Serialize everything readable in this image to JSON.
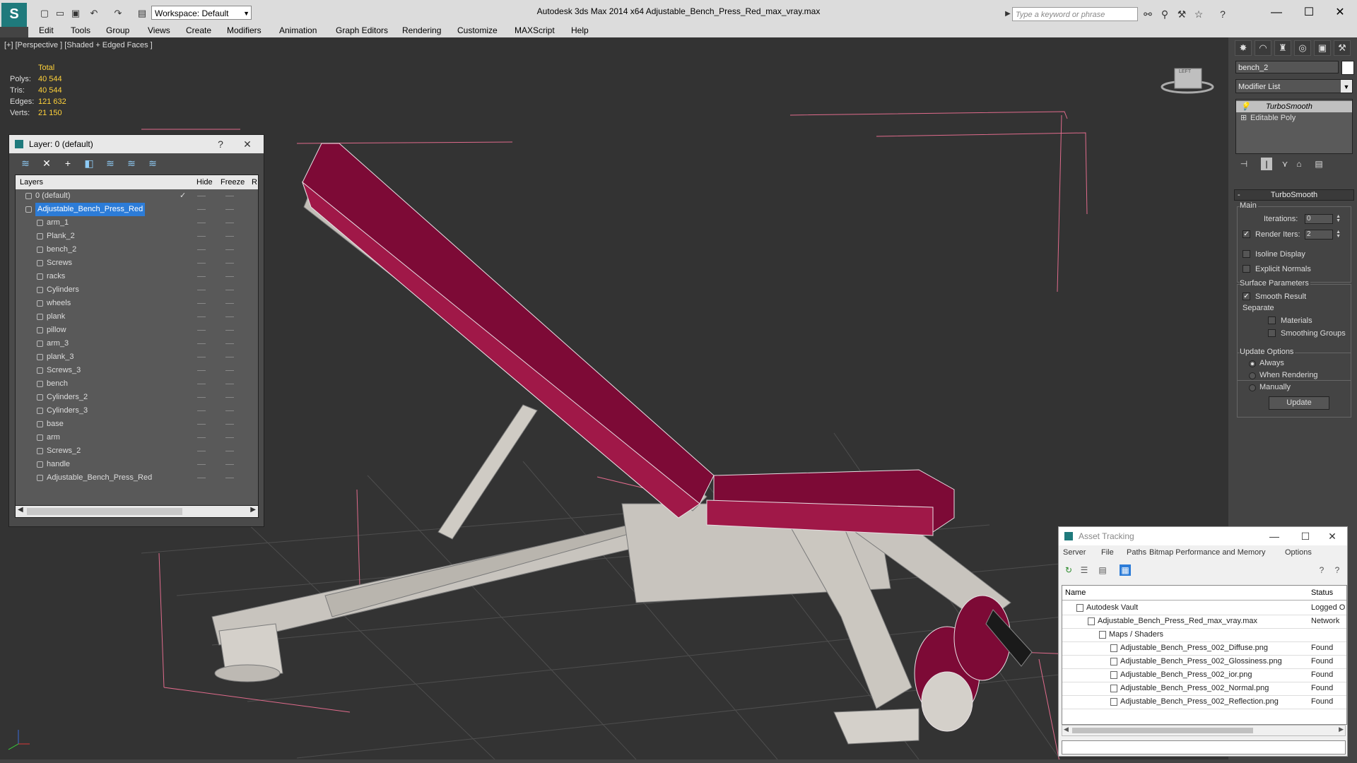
{
  "app": {
    "title": "Autodesk 3ds Max  2014 x64     Adjustable_Bench_Press_Red_max_vray.max",
    "workspace": "Workspace: Default",
    "search_placeholder": "Type a keyword or phrase"
  },
  "menu": [
    "Edit",
    "Tools",
    "Group",
    "Views",
    "Create",
    "Modifiers",
    "Animation",
    "Graph Editors",
    "Rendering",
    "Customize",
    "MAXScript",
    "Help"
  ],
  "viewport": {
    "label": "[+] [Perspective ] [Shaded + Edged Faces ]",
    "stats_header": "Total",
    "stats": [
      {
        "key": "Polys:",
        "value": "40 544"
      },
      {
        "key": "Tris:",
        "value": "40 544"
      },
      {
        "key": "Edges:",
        "value": "121 632"
      },
      {
        "key": "Verts:",
        "value": "21 150"
      }
    ],
    "viewcube_label": "LEFT"
  },
  "layer_panel": {
    "title": "Layer: 0 (default)",
    "help": "?",
    "close": "✕",
    "columns": [
      "Layers",
      "Hide",
      "Freeze",
      "R"
    ],
    "rows": [
      {
        "name": "0 (default)",
        "level": 1,
        "active": true
      },
      {
        "name": "Adjustable_Bench_Press_Red",
        "level": 1,
        "selected": true
      },
      {
        "name": "arm_1",
        "level": 2
      },
      {
        "name": "Plank_2",
        "level": 2
      },
      {
        "name": "bench_2",
        "level": 2
      },
      {
        "name": "Screws",
        "level": 2
      },
      {
        "name": "racks",
        "level": 2
      },
      {
        "name": "Cylinders",
        "level": 2
      },
      {
        "name": "wheels",
        "level": 2
      },
      {
        "name": "plank",
        "level": 2
      },
      {
        "name": "pillow",
        "level": 2
      },
      {
        "name": "arm_3",
        "level": 2
      },
      {
        "name": "plank_3",
        "level": 2
      },
      {
        "name": "Screws_3",
        "level": 2
      },
      {
        "name": "bench",
        "level": 2
      },
      {
        "name": "Cylinders_2",
        "level": 2
      },
      {
        "name": "Cylinders_3",
        "level": 2
      },
      {
        "name": "base",
        "level": 2
      },
      {
        "name": "arm",
        "level": 2
      },
      {
        "name": "Screws_2",
        "level": 2
      },
      {
        "name": "handle",
        "level": 2
      },
      {
        "name": "Adjustable_Bench_Press_Red",
        "level": 2
      }
    ]
  },
  "command_panel": {
    "object_name": "bench_2",
    "modifier_list": "Modifier List",
    "stack": [
      "TurboSmooth",
      "Editable Poly"
    ],
    "rollout_title": "TurboSmooth",
    "main_label": "Main",
    "iterations_label": "Iterations:",
    "iterations_value": "0",
    "render_iters_label": "Render Iters:",
    "render_iters_value": "2",
    "isoline_label": "Isoline Display",
    "explicit_normals_label": "Explicit Normals",
    "surface_params_label": "Surface Parameters",
    "smooth_result_label": "Smooth Result",
    "separate_label": "Separate",
    "materials_label": "Materials",
    "smoothing_groups_label": "Smoothing Groups",
    "update_options_label": "Update Options",
    "always_label": "Always",
    "when_rendering_label": "When Rendering",
    "manually_label": "Manually",
    "update_button": "Update"
  },
  "asset_tracking": {
    "title": "Asset Tracking",
    "menu": [
      "Server",
      "File",
      "Paths",
      "Bitmap Performance and Memory",
      "Options"
    ],
    "columns": [
      "Name",
      "Status"
    ],
    "rows": [
      {
        "name": "Autodesk Vault",
        "status": "Logged O",
        "level": 1
      },
      {
        "name": "Adjustable_Bench_Press_Red_max_vray.max",
        "status": "Network",
        "level": 2
      },
      {
        "name": "Maps / Shaders",
        "status": "",
        "level": 3
      },
      {
        "name": "Adjustable_Bench_Press_002_Diffuse.png",
        "status": "Found",
        "level": 4
      },
      {
        "name": "Adjustable_Bench_Press_002_Glossiness.png",
        "status": "Found",
        "level": 4
      },
      {
        "name": "Adjustable_Bench_Press_002_ior.png",
        "status": "Found",
        "level": 4
      },
      {
        "name": "Adjustable_Bench_Press_002_Normal.png",
        "status": "Found",
        "level": 4
      },
      {
        "name": "Adjustable_Bench_Press_002_Reflection.png",
        "status": "Found",
        "level": 4
      }
    ]
  },
  "colors": {
    "pad": "#7d0a36",
    "frame": "#c8c4be",
    "grid": "#4a4a4a",
    "selected_blue": "#2c7cd8"
  }
}
